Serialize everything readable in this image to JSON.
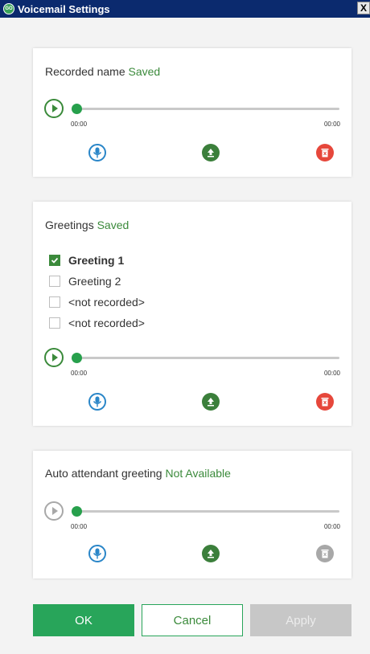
{
  "window": {
    "title": "Voicemail Settings",
    "close_label": "X",
    "logo_text": "GO"
  },
  "recorded_name": {
    "label": "Recorded name",
    "status": "Saved",
    "time_start": "00:00",
    "time_end": "00:00"
  },
  "greetings": {
    "label": "Greetings",
    "status": "Saved",
    "items": [
      {
        "label": "Greeting 1",
        "checked": true
      },
      {
        "label": "Greeting 2",
        "checked": false
      },
      {
        "label": "<not recorded>",
        "checked": false
      },
      {
        "label": "<not recorded>",
        "checked": false
      }
    ],
    "time_start": "00:00",
    "time_end": "00:00"
  },
  "auto_attendant": {
    "label": "Auto attendant greeting",
    "status": "Not Available",
    "time_start": "00:00",
    "time_end": "00:00"
  },
  "buttons": {
    "ok": "OK",
    "cancel": "Cancel",
    "apply": "Apply"
  },
  "colors": {
    "titlebar": "#0b2a6e",
    "accent_green": "#28a55a",
    "status_green": "#3b8a3b",
    "mic_blue": "#2a86c8",
    "delete_red": "#e6473b",
    "disabled_gray": "#a8a8a8"
  },
  "icons": {
    "play": "play-icon",
    "record": "microphone-icon",
    "upload": "upload-icon",
    "delete": "trash-icon",
    "check": "check-icon"
  }
}
